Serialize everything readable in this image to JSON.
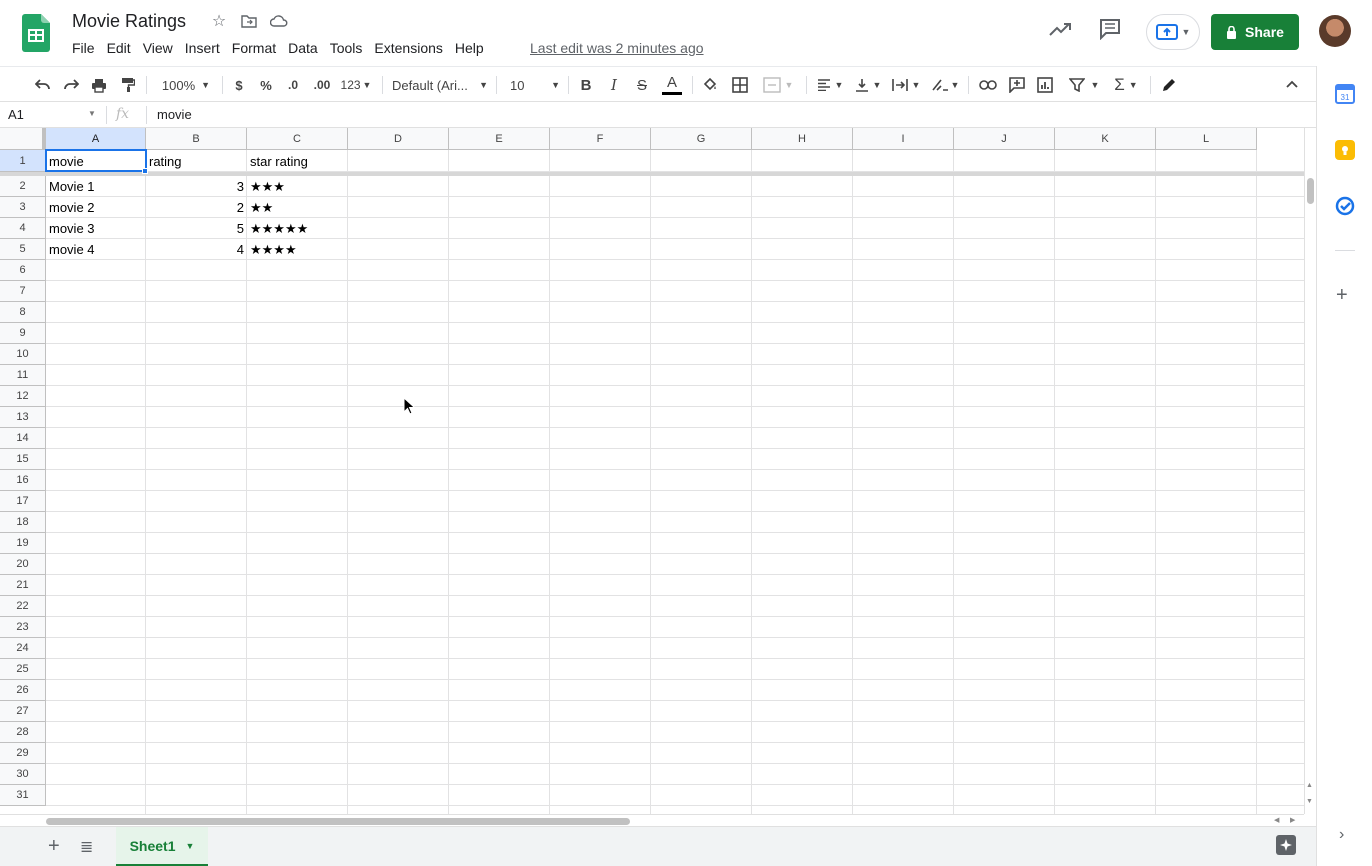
{
  "window": {
    "title": "Movie Ratings",
    "last_edit": "Last edit was 2 minutes ago"
  },
  "menu": [
    "File",
    "Edit",
    "View",
    "Insert",
    "Format",
    "Data",
    "Tools",
    "Extensions",
    "Help"
  ],
  "header": {
    "share_label": "Share"
  },
  "toolbar": {
    "zoom": "100%",
    "currency": "$",
    "percent": "%",
    "decimal_decrease": ".0",
    "decimal_increase": ".00",
    "more_formats": "123",
    "font": "Default (Ari...",
    "font_size": "10"
  },
  "formula_bar": {
    "cell_ref": "A1",
    "fx": "fx",
    "value": "movie"
  },
  "columns": [
    "A",
    "B",
    "C",
    "D",
    "E",
    "F",
    "G",
    "H",
    "I",
    "J",
    "K",
    "L"
  ],
  "row_numbers": [
    "1",
    "2",
    "3",
    "4",
    "5",
    "6",
    "7",
    "8",
    "9",
    "10",
    "11",
    "12",
    "13",
    "14",
    "15",
    "16",
    "17",
    "18",
    "19",
    "20",
    "21",
    "22",
    "23",
    "24",
    "25",
    "26",
    "27",
    "28",
    "29",
    "30",
    "31"
  ],
  "cells": [
    {
      "ref": "A1",
      "value": "movie"
    },
    {
      "ref": "B1",
      "value": "rating"
    },
    {
      "ref": "C1",
      "value": "star rating"
    },
    {
      "ref": "A2",
      "value": "Movie 1"
    },
    {
      "ref": "B2",
      "value": "3"
    },
    {
      "ref": "C2",
      "value": "★★★"
    },
    {
      "ref": "A3",
      "value": "movie 2"
    },
    {
      "ref": "B3",
      "value": "2"
    },
    {
      "ref": "C3",
      "value": "★★"
    },
    {
      "ref": "A4",
      "value": "movie 3"
    },
    {
      "ref": "B4",
      "value": "5"
    },
    {
      "ref": "C4",
      "value": "★★★★★"
    },
    {
      "ref": "A5",
      "value": "movie 4"
    },
    {
      "ref": "B5",
      "value": "4"
    },
    {
      "ref": "C5",
      "value": "★★★★"
    }
  ],
  "sheet_tabs": [
    {
      "label": "Sheet1",
      "active": true
    }
  ],
  "colors": {
    "accent_green": "#188038",
    "selection_blue": "#1a73e8"
  }
}
